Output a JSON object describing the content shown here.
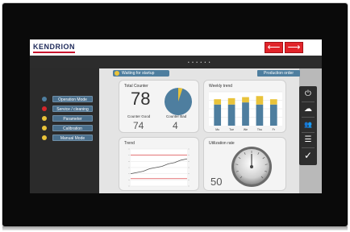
{
  "brand": {
    "logo_text": "KENDRION"
  },
  "header": {
    "back_icon": "arrow-left-icon",
    "forward_icon": "arrow-right-icon",
    "page_indicator": "• • • • • •",
    "accent_color": "#e1242a"
  },
  "status": {
    "message_label": "Waiting for startup",
    "production_button": "Production order"
  },
  "sidebar": {
    "items": [
      {
        "label": "Operation Mode",
        "status_color": "#4e7e9f"
      },
      {
        "label": "Service / cleaning",
        "status_color": "#d6262b"
      },
      {
        "label": "Parameter",
        "status_color": "#e9c33a"
      },
      {
        "label": "Calibration",
        "status_color": "#e9c33a"
      },
      {
        "label": "Manual Mode",
        "status_color": "#e9c33a"
      }
    ]
  },
  "counter": {
    "title": "Total Counter",
    "total": "78",
    "good_label": "Counter Good",
    "bad_label": "Counter Bad",
    "good": "74",
    "bad": "4",
    "pie": {
      "good": 74,
      "bad": 4,
      "good_color": "#4e7e9f",
      "bad_color": "#e9c33a"
    }
  },
  "weekly": {
    "title": "Weekly trend",
    "chart_data": {
      "type": "bar",
      "categories": [
        "Mo",
        "Tue",
        "We",
        "Thu",
        "Fr"
      ],
      "series": [
        {
          "values": [
            20,
            20,
            22,
            20,
            20
          ],
          "color": "#4e7e9f"
        },
        {
          "values": [
            5,
            6,
            5,
            8,
            5
          ],
          "color": "#e9c33a"
        }
      ],
      "ylim": [
        0,
        32
      ]
    }
  },
  "trend": {
    "title": "Trend",
    "chart_data": {
      "type": "line",
      "series": [
        {
          "values": [
            10,
            11,
            12,
            14,
            15,
            16,
            18,
            19,
            21,
            22
          ],
          "color": "#555555"
        }
      ],
      "limits": [
        25,
        6
      ],
      "limit_color": "#d6262b",
      "ylim": [
        0,
        30
      ]
    }
  },
  "utilization": {
    "title": "Utilization rate",
    "value": "50",
    "gauge_value": 50,
    "gauge_max": 100
  },
  "right_toolbar": {
    "icons": [
      "power-icon",
      "cloud-icon",
      "users-icon",
      "database-icon",
      "check-icon"
    ],
    "glyphs": [
      "⏻",
      "☁",
      "👥",
      "☰",
      "✓"
    ]
  }
}
